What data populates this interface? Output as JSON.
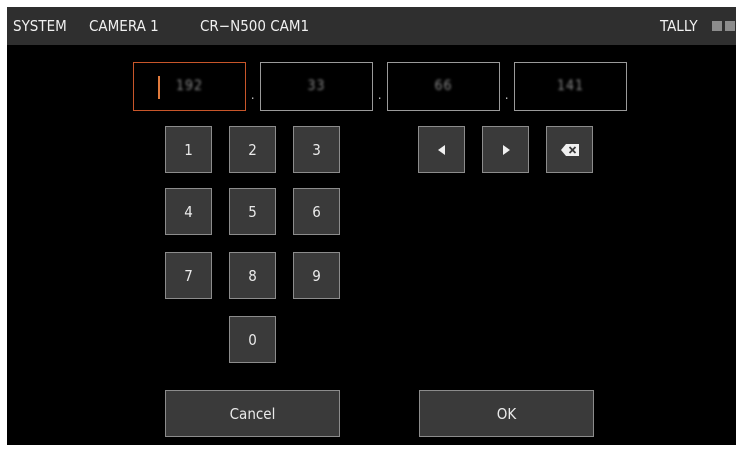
{
  "header": {
    "system": "SYSTEM",
    "camera": "CAMERA 1",
    "model": "CR−N500 CAM1",
    "tally_label": "TALLY"
  },
  "ip_fields": [
    {
      "value": "192",
      "active": true
    },
    {
      "value": "33"
    },
    {
      "value": "66"
    },
    {
      "value": "141"
    }
  ],
  "ip_separator": ".",
  "keypad": [
    "1",
    "2",
    "3",
    "4",
    "5",
    "6",
    "7",
    "8",
    "9",
    "0"
  ],
  "nav_icons": [
    "arrow-left-icon",
    "arrow-right-icon",
    "backspace-icon"
  ],
  "buttons": {
    "cancel": "Cancel",
    "ok": "OK"
  },
  "colors": {
    "header_bg": "#2f2f2f",
    "key_bg": "#3a3a3a",
    "active_border": "#c8562a",
    "tally": "#8c8c8c"
  }
}
